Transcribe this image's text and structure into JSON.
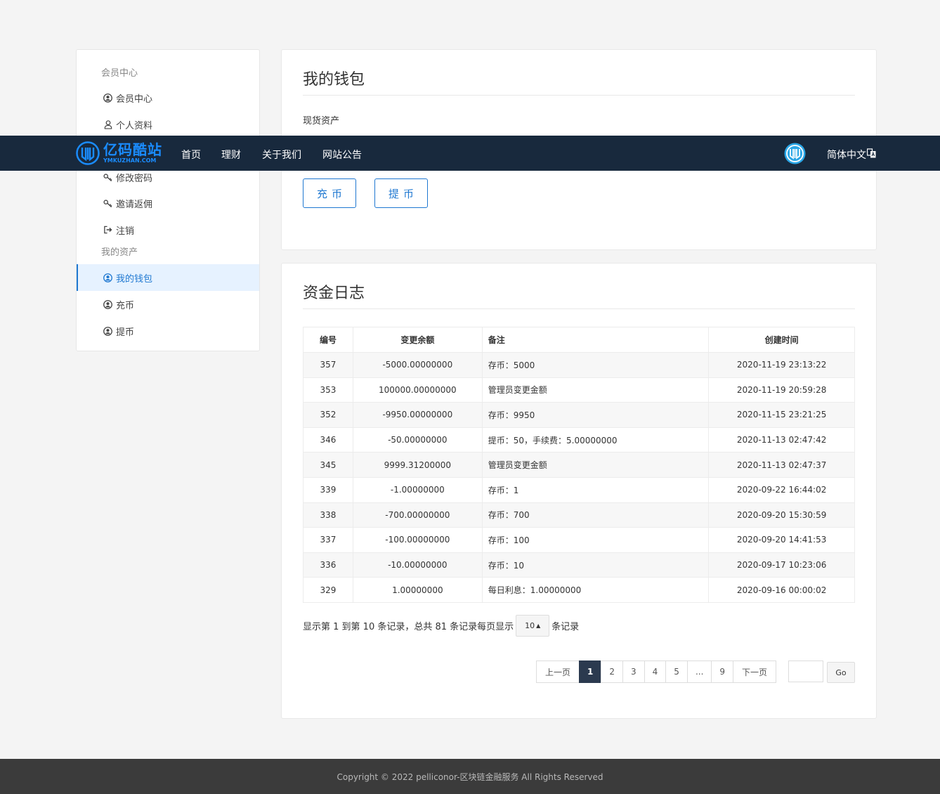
{
  "nav": {
    "logo_cn": "亿码酷站",
    "logo_en": "YMKUZHAN.COM",
    "links": [
      "首页",
      "理财",
      "关于我们",
      "网站公告"
    ],
    "lang": "简体中文"
  },
  "sidebar": {
    "group1": "会员中心",
    "group1_items": [
      "会员中心",
      "个人资料",
      "修改密码",
      "邀请返佣",
      "注销"
    ],
    "group2": "我的资产",
    "group2_items": [
      "我的钱包",
      "充币",
      "提币"
    ]
  },
  "wallet": {
    "title": "我的钱包",
    "spot_label": "现货资产",
    "deposit_label": "充币",
    "withdraw_label": "提币"
  },
  "log": {
    "title": "资金日志",
    "columns": [
      "编号",
      "变更余额",
      "备注",
      "创建时间"
    ],
    "rows": [
      [
        "357",
        "-5000.00000000",
        "存币：5000",
        "2020-11-19 23:13:22"
      ],
      [
        "353",
        "100000.00000000",
        "管理员变更金额",
        "2020-11-19 20:59:28"
      ],
      [
        "352",
        "-9950.00000000",
        "存币：9950",
        "2020-11-15 23:21:25"
      ],
      [
        "346",
        "-50.00000000",
        "提币：50，手续费：5.00000000",
        "2020-11-13 02:47:42"
      ],
      [
        "345",
        "9999.31200000",
        "管理员变更金额",
        "2020-11-13 02:47:37"
      ],
      [
        "339",
        "-1.00000000",
        "存币：1",
        "2020-09-22 16:44:02"
      ],
      [
        "338",
        "-700.00000000",
        "存币：700",
        "2020-09-20 15:30:59"
      ],
      [
        "337",
        "-100.00000000",
        "存币：100",
        "2020-09-20 14:41:53"
      ],
      [
        "336",
        "-10.00000000",
        "存币：10",
        "2020-09-17 10:23:06"
      ],
      [
        "329",
        "1.00000000",
        "每日利息：1.00000000",
        "2020-09-16 00:00:02"
      ]
    ],
    "summary_prefix": "显示第 1 到第 10 条记录，总共 81 条记录每页显示",
    "page_size": "10",
    "summary_suffix": "条记录",
    "pager": {
      "prev": "上一页",
      "pages": [
        "1",
        "2",
        "3",
        "4",
        "5",
        "...",
        "9"
      ],
      "next": "下一页",
      "go": "Go"
    }
  },
  "footer": {
    "text": "Copyright © 2022 pelliconor-区块链金融服务 All Rights Reserved"
  },
  "colors": {
    "accent": "#1f78d1",
    "nav_bg": "#18293d",
    "footer_bg": "#3b3b3b",
    "pager_active": "#2b3a4f"
  }
}
